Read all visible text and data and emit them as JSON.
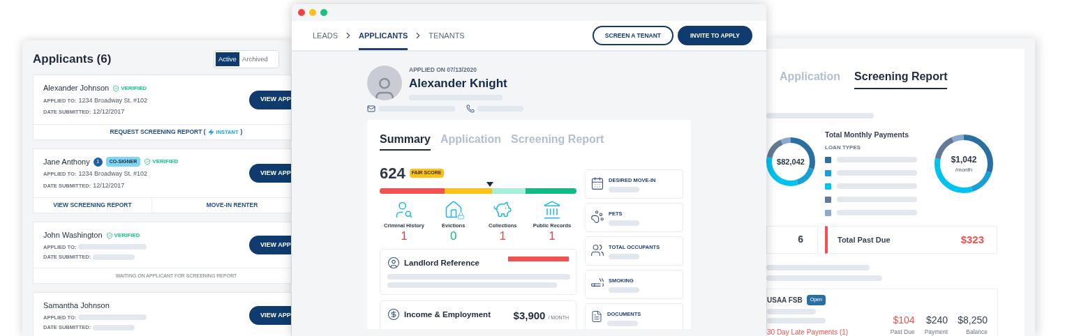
{
  "applicants_window": {
    "title": "Applicants (6)",
    "filter_tabs": [
      {
        "label": "Active",
        "selected": true
      },
      {
        "label": "Archived",
        "selected": false
      }
    ],
    "applicants": [
      {
        "name": "Alexander Johnson",
        "status": "VERIFIED",
        "applied_label": "APPLIED TO:",
        "applied_to": "1234 Broadway St. #102",
        "date_label": "DATE SUBMITTED:",
        "date": "12/12/2017",
        "button": "VIEW APP",
        "actions": [
          {
            "kind": "request",
            "label": "REQUEST SCREENING REPORT (",
            "tag": "INSTANT",
            "suffix": ")"
          }
        ]
      },
      {
        "name": "Jane Anthony",
        "count": "1",
        "tag": "CO-SIGNER",
        "status": "VERIFIED",
        "applied_label": "APPLIED TO:",
        "applied_to": "1234 Broadway St. #102",
        "date_label": "DATE SUBMITTED:",
        "date": "12/12/2017",
        "button": "VIEW APP",
        "actions": [
          {
            "kind": "link",
            "label": "VIEW SCREENING REPORT"
          },
          {
            "kind": "link",
            "label": "MOVE-IN RENTER"
          }
        ]
      },
      {
        "name": "John Washington",
        "status": "VERIFIED",
        "applied_label": "APPLIED TO:",
        "date_label": "DATE SUBMITTED:",
        "button": "VIEW APP",
        "actions": [
          {
            "kind": "note",
            "label": "WAITING ON APPLICANT FOR SCREENING REPORT"
          }
        ]
      },
      {
        "name": "Samantha Johnson",
        "applied_label": "APPLIED TO:",
        "date_label": "DATE SUBMITTED:",
        "button": "VIEW APP"
      }
    ]
  },
  "applicant_window": {
    "breadcrumbs": [
      {
        "label": "LEADS",
        "selected": false
      },
      {
        "label": "APPLICANTS",
        "selected": true
      },
      {
        "label": "TENANTS",
        "selected": false
      }
    ],
    "buttons": [
      {
        "label": "SCREEN A TENANT",
        "kind": "outline"
      },
      {
        "label": "INVITE TO APPLY",
        "kind": "primary"
      }
    ],
    "applied_on": "APPLIED ON 07/13/2020",
    "name": "Alexander Knight",
    "tabs": [
      {
        "label": "Summary",
        "selected": true
      },
      {
        "label": "Application",
        "selected": false
      },
      {
        "label": "Screening Report",
        "selected": false
      }
    ],
    "score": {
      "value": "624",
      "badge": "FAIR SCORE",
      "level": 0.56
    },
    "records": [
      {
        "kind": "criminal",
        "label": "Criminal History",
        "count": "1",
        "color": "#ef4444"
      },
      {
        "kind": "evictions",
        "label": "Evictions",
        "count": "0",
        "color": "#10b981"
      },
      {
        "kind": "collections",
        "label": "Collections",
        "count": "1",
        "color": "#ef4444"
      },
      {
        "kind": "public",
        "label": "Public Records",
        "count": "1",
        "color": "#ef4444"
      }
    ],
    "landlord": {
      "title": "Landlord Reference"
    },
    "income": {
      "title": "Income & Employment",
      "amount": "$3,900",
      "unit": "/ MONTH"
    },
    "details": [
      {
        "kind": "calendar",
        "label": "DESIRED MOVE-IN"
      },
      {
        "kind": "pets",
        "label": "PETS"
      },
      {
        "kind": "occupants",
        "label": "TOTAL OCCUPANTS"
      },
      {
        "kind": "smoking",
        "label": "SMOKING"
      },
      {
        "kind": "documents",
        "label": "DOCUMENTS"
      }
    ]
  },
  "report_window": {
    "tabs": [
      {
        "label": "Application",
        "selected": false
      },
      {
        "label": "Screening Report",
        "selected": true
      }
    ],
    "total_balance": "$82,042",
    "monthly_title": "Total Monthly Payments",
    "loan_types_label": "LOAN TYPES",
    "loan_types": [
      {
        "color": "#2a6fa1"
      },
      {
        "color": "#1a9fd6"
      },
      {
        "color": "#00c2ef"
      },
      {
        "color": "#637a96"
      },
      {
        "color": "#8aa9cf"
      }
    ],
    "monthly_amount": "$1,042",
    "monthly_unit": "/month",
    "accounts_count": "6",
    "past_due_label": "Total Past Due",
    "past_due": "$323",
    "account": {
      "name": "USAA FSB",
      "badge": "Open",
      "late": "30 Day Late Payments (1)",
      "figures": [
        {
          "value": "$104",
          "label": "Past Due",
          "alert": true
        },
        {
          "value": "$240",
          "label": "Payment",
          "alert": false
        },
        {
          "value": "$8,250",
          "label": "Balance",
          "alert": false
        }
      ]
    }
  }
}
